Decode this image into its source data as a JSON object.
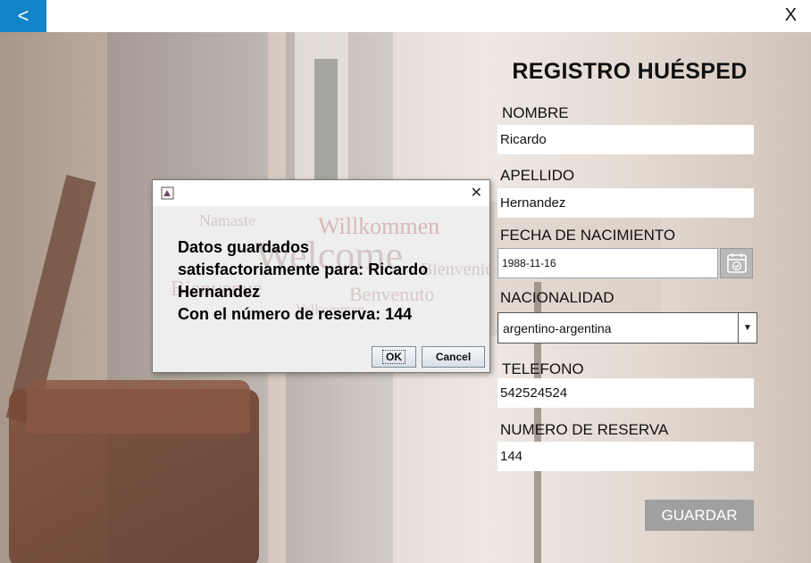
{
  "nav": {
    "back_label": "<",
    "close_label": "X"
  },
  "form": {
    "title": "REGISTRO HUÉSPED",
    "nombre": {
      "label": "NOMBRE",
      "value": "Ricardo"
    },
    "apellido": {
      "label": "APELLIDO",
      "value": "Hernandez"
    },
    "fecha": {
      "label": "FECHA DE NACIMIENTO",
      "value": "1988-11-16"
    },
    "nacionalidad": {
      "label": "NACIONALIDAD",
      "value": "argentino-argentina"
    },
    "telefono": {
      "label": "TELEFONO",
      "value": "542524524"
    },
    "reserva": {
      "label": "NUMERO DE RESERVA",
      "value": "144"
    },
    "save_label": "GUARDAR"
  },
  "dialog": {
    "message_lines": [
      "Datos guardados",
      "satisfactoriamente para: Ricardo",
      "Hernandez",
      "Con el número de reserva: 144"
    ],
    "ok_label": "OK",
    "cancel_label": "Cancel",
    "watermark": [
      "Namaste",
      "Willkommen",
      "Welcome",
      "Bienvenue",
      "Benvenuto",
      "Bienvenido",
      "Velkommen"
    ]
  },
  "colors": {
    "accent": "#1185c8",
    "save_button": "#a0a0a0"
  }
}
